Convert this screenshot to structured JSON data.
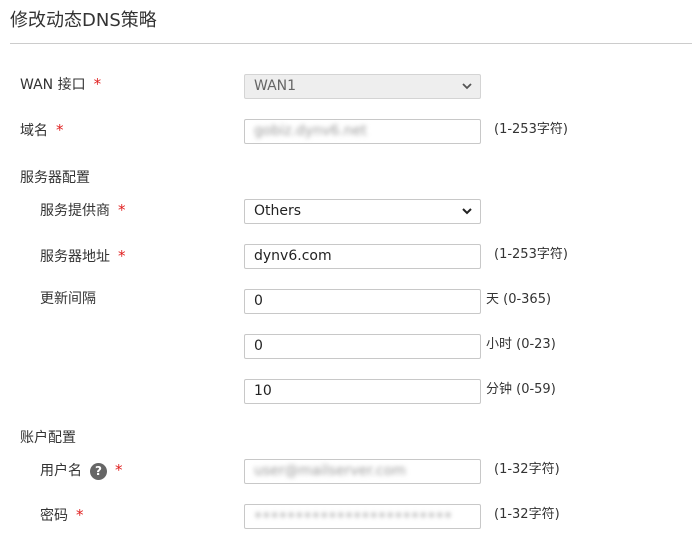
{
  "page": {
    "title": "修改动态DNS策略"
  },
  "form": {
    "wan": {
      "label": "WAN 接口",
      "required_mark": "*",
      "value": "WAN1"
    },
    "domain": {
      "label": "域名",
      "required_mark": "*",
      "value": "gobiz.dynv6.net",
      "hint": "(1-253字符)"
    },
    "server_section": {
      "label": "服务器配置"
    },
    "provider": {
      "label": "服务提供商",
      "required_mark": "*",
      "value": "Others"
    },
    "server_address": {
      "label": "服务器地址",
      "required_mark": "*",
      "value": "dynv6.com",
      "hint": "(1-253字符)"
    },
    "update_interval": {
      "label": "更新间隔",
      "days_value": "0",
      "days_hint": "天 (0-365)",
      "hours_value": "0",
      "hours_hint": "小时 (0-23)",
      "minutes_value": "10",
      "minutes_hint": "分钟 (0-59)"
    },
    "account_section": {
      "label": "账户配置"
    },
    "username": {
      "label": "用户名",
      "help_icon": "?",
      "required_mark": "*",
      "value": "user@mailserver.com",
      "hint": "(1-32字符)"
    },
    "password": {
      "label": "密码",
      "required_mark": "*",
      "value": "••••••••••••••••••••••••",
      "hint": "(1-32字符)"
    }
  },
  "colors": {
    "required": "#e02020",
    "border": "#c8c8c8",
    "disabled_bg": "#eeeeee"
  }
}
